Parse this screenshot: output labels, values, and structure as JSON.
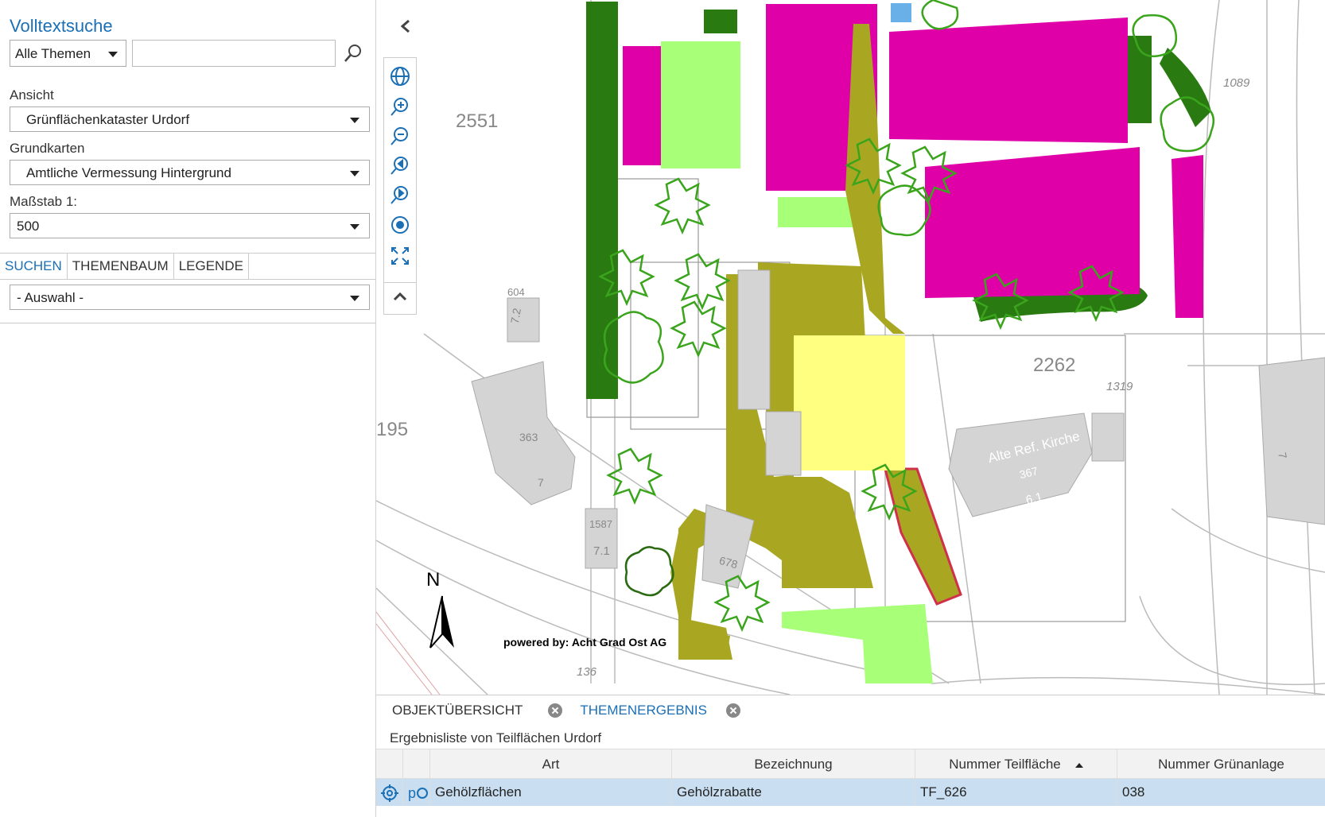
{
  "left_panel": {
    "title": "Volltextsuche",
    "theme_select": "Alle Themen",
    "search_placeholder": "",
    "ansicht_label": "Ansicht",
    "ansicht_value": "Grünflächenkataster Urdorf",
    "grundkarten_label": "Grundkarten",
    "grundkarten_value": "Amtliche Vermessung Hintergrund",
    "massstab_label": "Maßstab 1:",
    "massstab_value": "500",
    "tabs": [
      "SUCHEN",
      "THEMENBAUM",
      "LEGENDE"
    ],
    "auswahl_value": "- Auswahl -"
  },
  "map": {
    "toolbar_icons": [
      "globe-icon",
      "zoom-in-icon",
      "zoom-out-icon",
      "zoom-previous-icon",
      "zoom-next-icon",
      "locate-icon",
      "full-extent-icon",
      "collapse-up-icon"
    ],
    "labels": {
      "parcel_2551": "2551",
      "parcel_2262": "2262",
      "parcel_195": "195",
      "n_1089": "1089",
      "n_1319": "1319",
      "n_604": "604",
      "n_72": "7.2",
      "n_363": "363",
      "n_7a": "7",
      "n_1587": "1587",
      "n_71": "7.1",
      "n_678": "678",
      "n_136": "136",
      "church": "Alte Ref. Kirche",
      "n_367": "367",
      "n_61": "6.1",
      "n_7b": "7"
    },
    "north": "N",
    "powered_by": "powered by: Acht Grad Ost AG",
    "colors": {
      "magenta": "#e000a8",
      "dark_green": "#2a7a12",
      "light_green": "#a8ff78",
      "olive": "#a9a722",
      "yellow": "#ffff80",
      "building_gray": "#d4d4d4",
      "highlight_red": "#d0304a"
    }
  },
  "bottom_panel": {
    "tabs": [
      {
        "label": "OBJEKTÜBERSICHT"
      },
      {
        "label": "THEMENERGEBNIS"
      }
    ],
    "result_title": "Ergebnisliste von Teilflächen Urdorf",
    "columns": [
      "Art",
      "Bezeichnung",
      "Nummer Teilfläche",
      "Nummer Grünanlage"
    ],
    "rows": [
      {
        "art": "Gehölzflächen",
        "bezeichnung": "Gehölzrabatte",
        "nummer_teilflaeche": "TF_626",
        "nummer_gruenanlage": "038"
      }
    ]
  }
}
